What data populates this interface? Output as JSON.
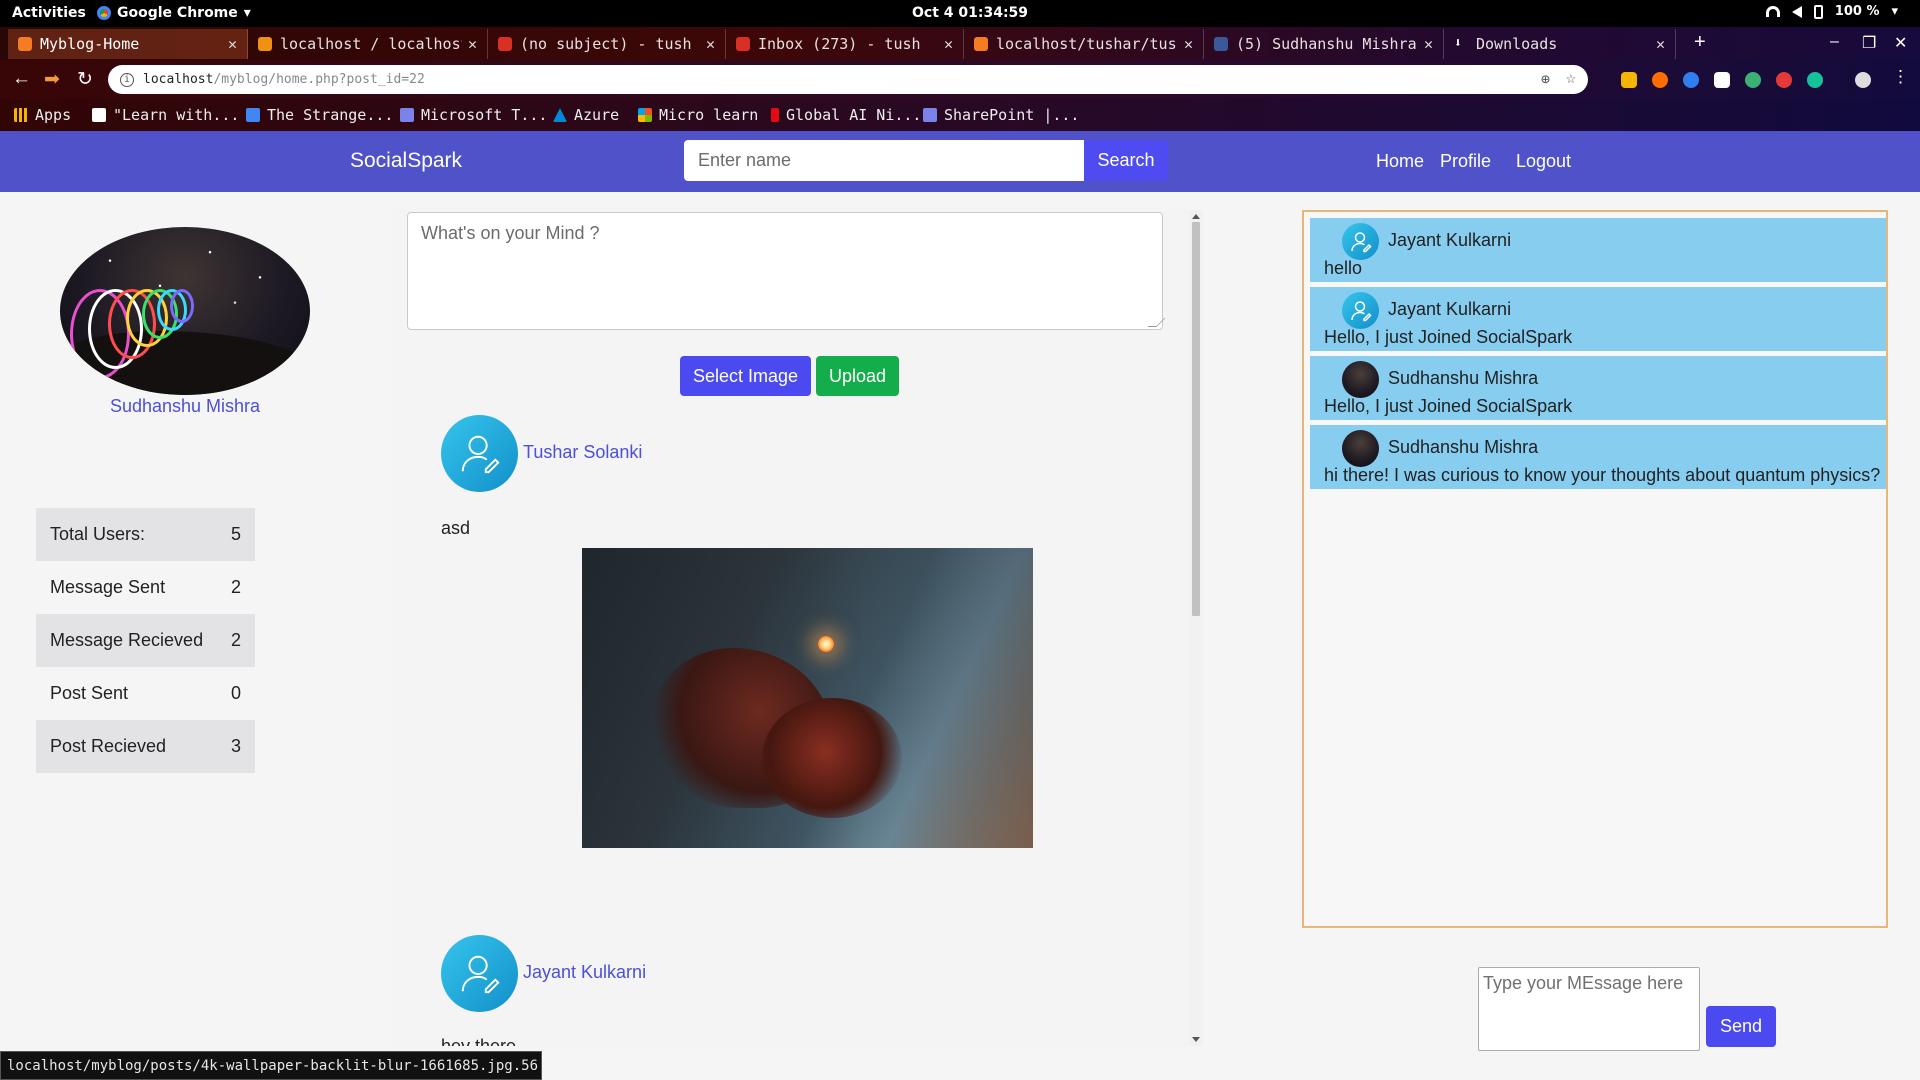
{
  "gnome": {
    "activities": "Activities",
    "app_name": "Google Chrome",
    "clock": "Oct 4  01:34:59",
    "battery": "100 %"
  },
  "tabs": [
    {
      "title": "Myblog-Home",
      "favicon_color": "#f57c22",
      "active": true
    },
    {
      "title": "localhost / localhost",
      "favicon_color": "#f29111",
      "active": false
    },
    {
      "title": "(no subject) - tush",
      "favicon_color": "#d93025",
      "active": false
    },
    {
      "title": "Inbox (273) - tush",
      "favicon_color": "#d93025",
      "active": false
    },
    {
      "title": "localhost/tushar/tush",
      "favicon_color": "#f57c22",
      "active": false
    },
    {
      "title": "(5) Sudhanshu Mishra",
      "favicon_color": "#3b5998",
      "active": false
    },
    {
      "title": "Downloads",
      "favicon_color": "#ffffff",
      "active": false
    }
  ],
  "address": {
    "host": "localhost",
    "path": "/myblog/home.php?post_id=22"
  },
  "bookmarks": [
    {
      "label": "Apps",
      "color": "#f4b400"
    },
    {
      "label": "\"Learn with...",
      "color": "#ffffff"
    },
    {
      "label": "The Strange...",
      "color": "#4285f4"
    },
    {
      "label": "Microsoft T...",
      "color": "#7b83eb"
    },
    {
      "label": "Azure",
      "color": "#0089d6"
    },
    {
      "label": "Micro learn",
      "color": "#f25022"
    },
    {
      "label": "Global AI Ni...",
      "color": "#e50914"
    },
    {
      "label": "SharePoint |...",
      "color": "#7b83eb"
    }
  ],
  "app": {
    "brand": "SocialSpark",
    "search_placeholder": "Enter name",
    "search_label": "Search",
    "nav": {
      "home": "Home",
      "profile": "Profile",
      "logout": "Logout"
    },
    "colors": {
      "navbar": "#4f52c9",
      "primary_button": "#4a4af0",
      "upload_button": "#14ad4c",
      "chat_bubble": "#86cdf0",
      "link": "#4d4fd6"
    }
  },
  "profile": {
    "name": "Sudhanshu Mishra",
    "stats": [
      {
        "label": "Total Users:",
        "value": "5"
      },
      {
        "label": "Message Sent",
        "value": "2"
      },
      {
        "label": "Message Recieved",
        "value": "2"
      },
      {
        "label": "Post Sent",
        "value": "0"
      },
      {
        "label": "Post Recieved",
        "value": "3"
      }
    ]
  },
  "composer": {
    "placeholder": "What's on your Mind ?",
    "select_image": "Select Image",
    "upload": "Upload"
  },
  "posts": [
    {
      "author": "Tushar Solanki",
      "text": "asd",
      "has_image": true
    },
    {
      "author": "Jayant Kulkarni",
      "text": "hey there",
      "has_image": false
    }
  ],
  "chat": {
    "messages": [
      {
        "sender": "Jayant Kulkarni",
        "text": "hello",
        "avatar": "user-icon"
      },
      {
        "sender": "Jayant Kulkarni",
        "text": "Hello, I just Joined SocialSpark",
        "avatar": "user-icon"
      },
      {
        "sender": "Sudhanshu Mishra",
        "text": "Hello, I just Joined SocialSpark",
        "avatar": "photo"
      },
      {
        "sender": "Sudhanshu Mishra",
        "text": "hi there! I was curious to know your thoughts about quantum physics?",
        "avatar": "photo"
      }
    ],
    "input_placeholder": "Type your MEssage here",
    "send_label": "Send"
  },
  "status_url": "localhost/myblog/posts/4k-wallpaper-backlit-blur-1661685.jpg.56"
}
